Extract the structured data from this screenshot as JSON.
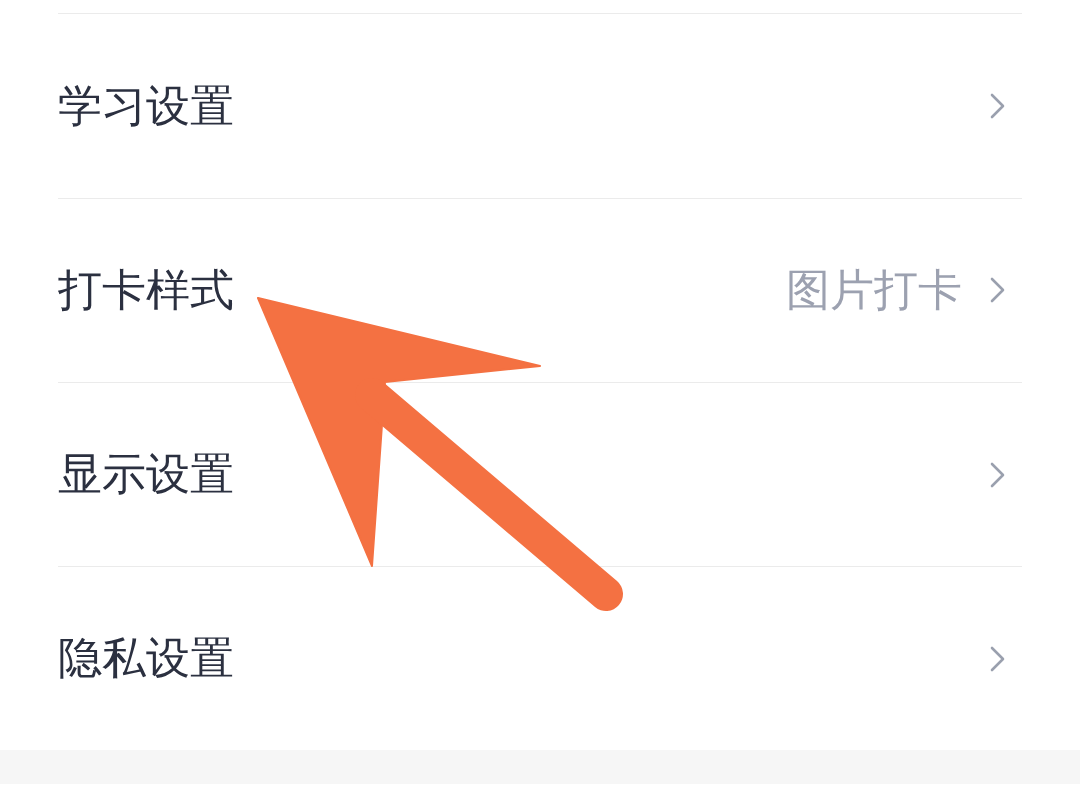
{
  "settings": [
    {
      "label": "学习设置"
    },
    {
      "label": "打卡样式",
      "value": "图片打卡"
    },
    {
      "label": "显示设置"
    },
    {
      "label": "隐私设置"
    }
  ],
  "annotation": {
    "kind": "arrow"
  }
}
